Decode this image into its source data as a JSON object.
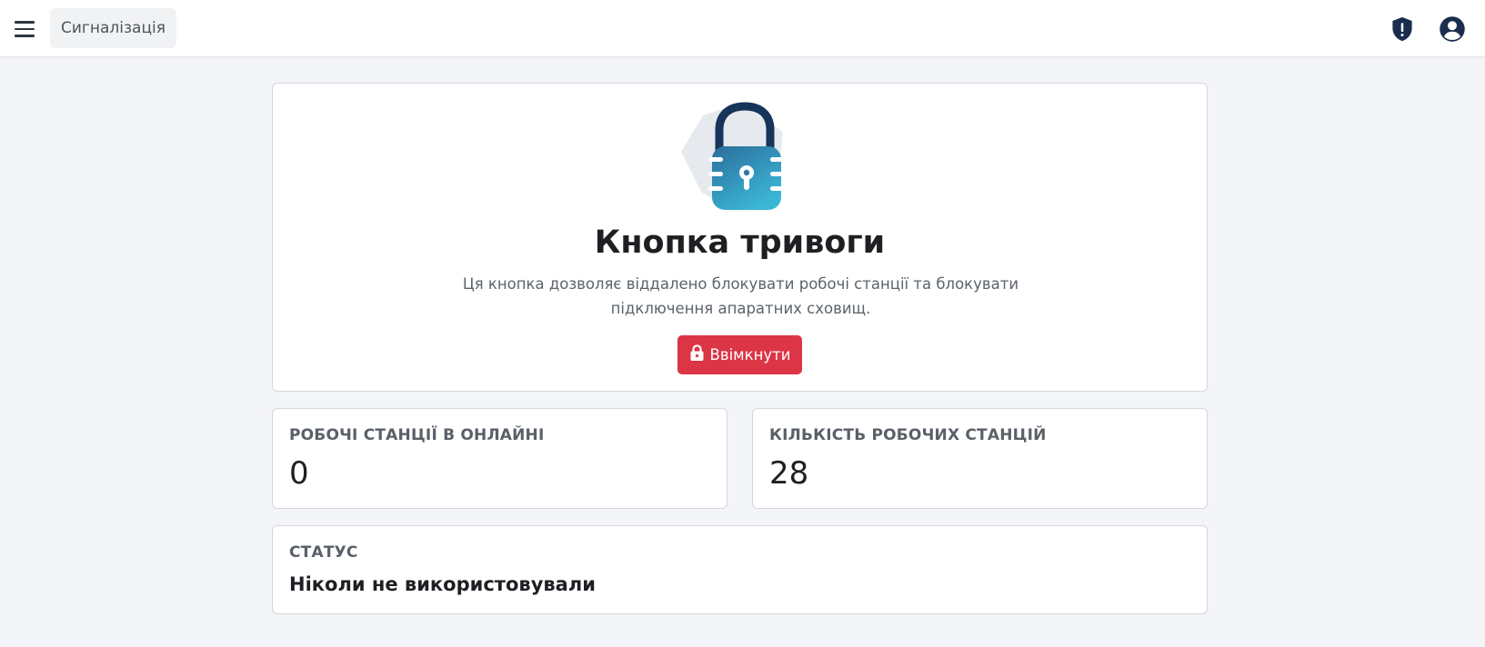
{
  "header": {
    "app_name": "Сигналізація",
    "icons": [
      "menu-icon",
      "shield-alert-icon",
      "user-circle-icon"
    ]
  },
  "hero": {
    "title": "Кнопка тривоги",
    "description": "Ця кнопка дозволяє віддалено блокувати робочі станції та блокувати підключення апаратних сховищ.",
    "button_label": "Ввімкнути",
    "button_icon": "lock-icon",
    "illustration": "padlock-icon"
  },
  "stats": {
    "online": {
      "label": "РОБОЧІ СТАНЦІЇ В ОНЛАЙНІ",
      "value": "0"
    },
    "total": {
      "label": "КІЛЬКІСТЬ РОБОЧИХ СТАНЦІЙ",
      "value": "28"
    }
  },
  "status": {
    "label": "СТАТУС",
    "value": "Ніколи не використовували"
  },
  "colors": {
    "accent_danger": "#dc3545",
    "brand_dark": "#1a2d4d",
    "lock_body": "#2a8fb5",
    "page_background": "#f4f5f8"
  }
}
